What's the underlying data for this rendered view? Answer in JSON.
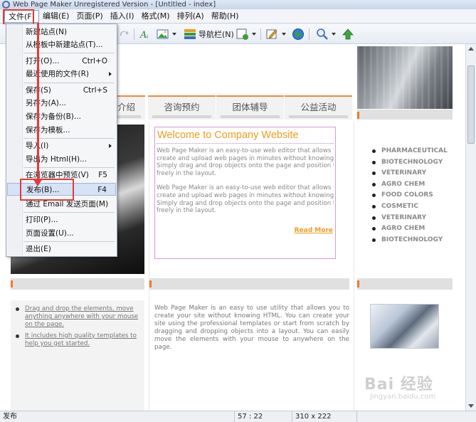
{
  "window": {
    "title": "Web Page Maker Unregistered Version - [Untitled - index]"
  },
  "menubar": {
    "items": [
      {
        "label": "文件(F)"
      },
      {
        "label": "编辑(E)"
      },
      {
        "label": "页面(P)"
      },
      {
        "label": "插入(I)"
      },
      {
        "label": "格式(M)"
      },
      {
        "label": "排列(A)"
      },
      {
        "label": "帮助(H)"
      }
    ]
  },
  "toolbar": {
    "navbar_label": "导航栏(N)"
  },
  "file_menu": {
    "items": [
      {
        "label": "新建站点(N)",
        "shortcut": ""
      },
      {
        "label": "从模板中新建站点(T)...",
        "shortcut": ""
      },
      {
        "label": "打开(O)...",
        "shortcut": "Ctrl+O"
      },
      {
        "label": "最近使用的文件(R)",
        "shortcut": ""
      },
      {
        "label": "保存(S)",
        "shortcut": "Ctrl+S"
      },
      {
        "label": "另存为(A)...",
        "shortcut": ""
      },
      {
        "label": "保存为备份(B)...",
        "shortcut": ""
      },
      {
        "label": "保存为模板...",
        "shortcut": ""
      },
      {
        "label": "导入(I)",
        "shortcut": ""
      },
      {
        "label": "导出为 Html(H)...",
        "shortcut": ""
      },
      {
        "label": "在浏览器中预览(V)",
        "shortcut": "F5"
      },
      {
        "label": "发布(B)...",
        "shortcut": "F4"
      },
      {
        "label": "通过 Email 发送页面(M)",
        "shortcut": ""
      },
      {
        "label": "打印(P)...",
        "shortcut": ""
      },
      {
        "label": "页面设置(U)...",
        "shortcut": ""
      },
      {
        "label": "退出(E)",
        "shortcut": ""
      }
    ]
  },
  "page": {
    "nav_tabs": [
      "介绍",
      "咨询预约",
      "团体辅导",
      "公益活动"
    ],
    "welcome": {
      "title": "Welcome to Company Website",
      "para1": [
        "Web Page Maker is an easy-to-use web editor that allows you to",
        "create and upload web pages in minutes without knowing HTML.",
        "Simply drag and drop objects onto the page and position them",
        "freely in the layout."
      ],
      "para2": [
        "Web Page Maker is an easy-to-use web editor that allows you to",
        "create and upload web pages in minutes without knowing HTML.",
        "Simply drag and drop objects onto the page and position them",
        "freely in the layout."
      ],
      "read_more": "Read More"
    },
    "right_list": [
      "PHARMACEUTICAL",
      "BIOTECHNOLOGY",
      "VETERINARY",
      "AGRO CHEM",
      "FOOD COLORS",
      "COSMETIC",
      "VETERINARY",
      "AGRO CHEM",
      "BIOTECHNOLOGY"
    ],
    "left_list": [
      "Drag and drop the elements, move anything anywhere with your mouse on the page.",
      "It includes high quality templates to help you get started."
    ],
    "mid_text": "Web Page Maker is an easy to use utility that allows you to create your site without knowing HTML. You can create your site using the professional templates or start from scratch by dragging and dropping objects into a layout. You can easily move the elements with your mouse to anywhere on the page.",
    "watermark": "Bai 经验",
    "watermark_url": "jingyan.baidu.com"
  },
  "statusbar": {
    "text": "发布",
    "cursor": "57 : 22",
    "size": "310 x 222"
  },
  "colors": {
    "accent_orange": "#f29a1c",
    "highlight_red": "#e23b3b",
    "menu_highlight": "#d6e2f5"
  }
}
